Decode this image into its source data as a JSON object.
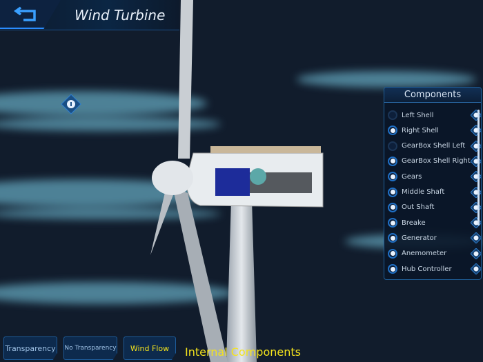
{
  "header": {
    "title": "Wind Turbine",
    "back_icon": "back-arrow-icon"
  },
  "panel": {
    "title": "Components",
    "items": [
      {
        "label": "Left Shell",
        "checked": false
      },
      {
        "label": "Right Shell",
        "checked": true
      },
      {
        "label": "GearBox Shell Left",
        "checked": false
      },
      {
        "label": "GearBox Shell Right",
        "checked": true
      },
      {
        "label": "Gears",
        "checked": true
      },
      {
        "label": "Middle Shaft",
        "checked": true
      },
      {
        "label": "Out Shaft",
        "checked": true
      },
      {
        "label": "Breake",
        "checked": true
      },
      {
        "label": "Generator",
        "checked": true
      },
      {
        "label": "Anemometer",
        "checked": true
      },
      {
        "label": "Hub Controller",
        "checked": true
      }
    ]
  },
  "toolbar": {
    "transparency": "Transparency",
    "no_transparency": "No Transparency",
    "wind_flow": "Wind Flow"
  },
  "caption": "Internal Components",
  "colors": {
    "accent": "#1f6fc4",
    "caption": "#f5e41c",
    "background": "#111c2c"
  }
}
